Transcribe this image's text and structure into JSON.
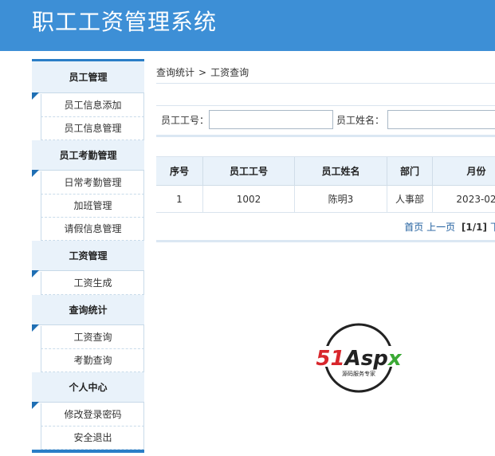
{
  "header": {
    "title": "职工工资管理系统"
  },
  "sidebar": {
    "groups": [
      {
        "title": "员工管理",
        "items": [
          "员工信息添加",
          "员工信息管理"
        ]
      },
      {
        "title": "员工考勤管理",
        "items": [
          "日常考勤管理",
          "加班管理",
          "请假信息管理"
        ]
      },
      {
        "title": "工资管理",
        "items": [
          "工资生成"
        ]
      },
      {
        "title": "查询统计",
        "items": [
          "工资查询",
          "考勤查询"
        ]
      },
      {
        "title": "个人中心",
        "items": [
          "修改登录密码",
          "安全退出"
        ]
      }
    ]
  },
  "breadcrumb": {
    "parent": "查询统计",
    "separator": ">",
    "current": "工资查询"
  },
  "search": {
    "emp_no_label": "员工工号：",
    "emp_no_value": "",
    "emp_name_label": "员工姓名：",
    "emp_name_value": ""
  },
  "table": {
    "headers": [
      "序号",
      "员工工号",
      "员工姓名",
      "部门",
      "月份"
    ],
    "rows": [
      [
        "1",
        "1002",
        "陈明3",
        "人事部",
        "2023-02"
      ]
    ]
  },
  "pager": {
    "first": "首页",
    "prev": "上一页",
    "current": "[1/1]",
    "next": "下"
  },
  "logo": {
    "text": "51Aspx",
    "subtitle": "源码服务专家"
  }
}
